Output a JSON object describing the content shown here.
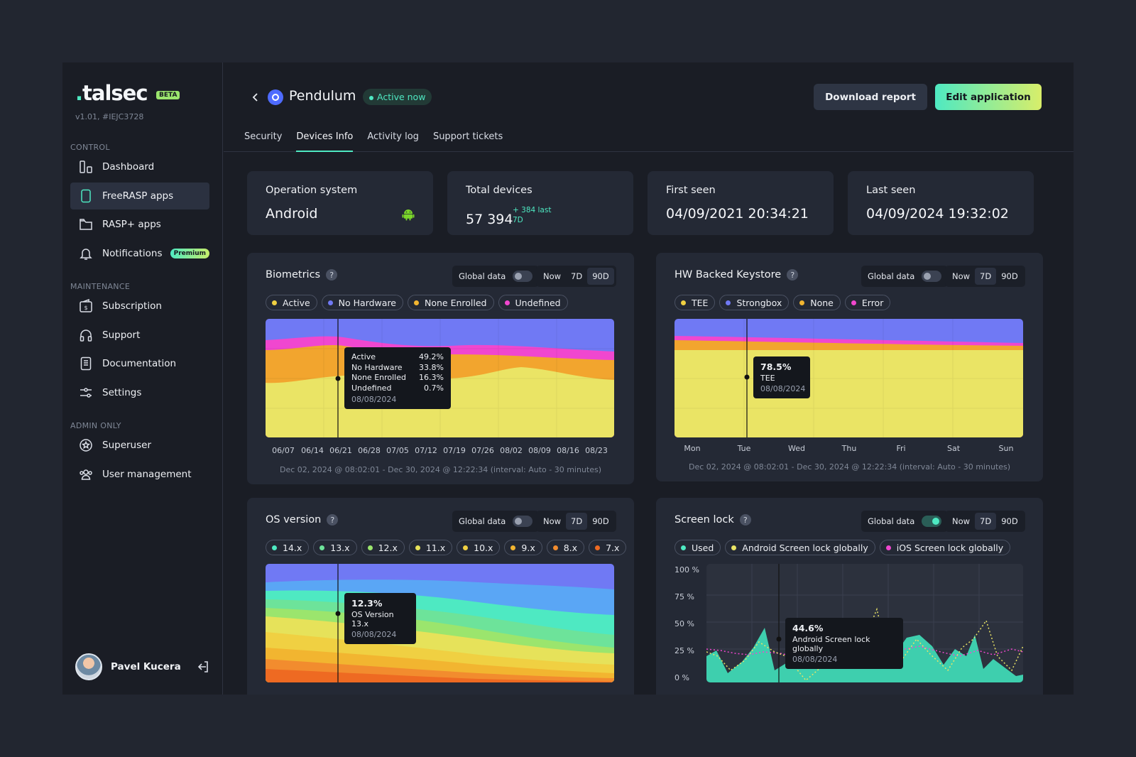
{
  "brand": {
    "logo_text": "talsec",
    "badge": "BETA",
    "version": "v1.01, #IEJC3728"
  },
  "sidebar": {
    "sections": [
      {
        "title": "CONTROL",
        "items": [
          {
            "label": "Dashboard",
            "icon": "dashboard-icon"
          },
          {
            "label": "FreeRASP apps",
            "icon": "phone-icon",
            "active": true
          },
          {
            "label": "RASP+ apps",
            "icon": "folder-icon"
          },
          {
            "label": "Notifications",
            "icon": "bell-icon",
            "badge": "Premium"
          }
        ]
      },
      {
        "title": "MAINTENANCE",
        "items": [
          {
            "label": "Subscription",
            "icon": "wallet-icon"
          },
          {
            "label": "Support",
            "icon": "headphones-icon"
          },
          {
            "label": "Documentation",
            "icon": "document-icon"
          },
          {
            "label": "Settings",
            "icon": "sliders-icon"
          }
        ]
      },
      {
        "title": "ADMIN ONLY",
        "items": [
          {
            "label": "Superuser",
            "icon": "star-badge-icon"
          },
          {
            "label": "User management",
            "icon": "users-icon"
          }
        ]
      }
    ],
    "user": {
      "name": "Pavel Kucera"
    }
  },
  "header": {
    "app_name": "Pendulum",
    "status": "Active now",
    "download_label": "Download report",
    "edit_label": "Edit application",
    "tabs": [
      {
        "label": "Security"
      },
      {
        "label": "Devices Info",
        "active": true
      },
      {
        "label": "Activity log"
      },
      {
        "label": "Support tickets"
      }
    ]
  },
  "stats": [
    {
      "label": "Operation system",
      "value": "Android",
      "icon": "android-icon"
    },
    {
      "label": "Total devices",
      "value": "57 394",
      "delta": "+ 384 last 7D"
    },
    {
      "label": "First seen",
      "value": "04/09/2021 20:34:21"
    },
    {
      "label": "Last seen",
      "value": "04/09/2024 19:32:02"
    }
  ],
  "controls": {
    "global_label": "Global data",
    "seg": [
      "Now",
      "7D",
      "90D"
    ]
  },
  "colors": {
    "accent": "#4ee9c2",
    "yellow": "#eae465",
    "orange": "#f2a52e",
    "pink": "#f047cf",
    "blue": "#7079f4"
  },
  "cards": {
    "biometrics": {
      "title": "Biometrics",
      "legend": [
        {
          "label": "Active",
          "color": "#f0d042"
        },
        {
          "label": "No Hardware",
          "color": "#7079f4"
        },
        {
          "label": "None Enrolled",
          "color": "#f2b530"
        },
        {
          "label": "Undefined",
          "color": "#f047cf"
        }
      ],
      "x_ticks": [
        "06/07",
        "06/14",
        "06/21",
        "06/28",
        "07/05",
        "07/12",
        "07/19",
        "07/26",
        "08/02",
        "08/09",
        "08/16",
        "08/23"
      ],
      "range": "Dec 02, 2024 @ 08:02:01 - Dec 30, 2024 @ 12:22:34 (interval: Auto - 30 minutes)",
      "tooltip": {
        "rows": [
          [
            "Active",
            "49.2%"
          ],
          [
            "No Hardware",
            "33.8%"
          ],
          [
            "None Enrolled",
            "16.3%"
          ],
          [
            "Undefined",
            "0.7%"
          ]
        ],
        "date": "08/08/2024"
      }
    },
    "hw": {
      "title": "HW Backed Keystore",
      "legend": [
        {
          "label": "TEE",
          "color": "#f0d042"
        },
        {
          "label": "Strongbox",
          "color": "#7079f4"
        },
        {
          "label": "None",
          "color": "#f2b530"
        },
        {
          "label": "Error",
          "color": "#f047cf"
        }
      ],
      "x_ticks": [
        "Mon",
        "Tue",
        "Wed",
        "Thu",
        "Fri",
        "Sat",
        "Sun"
      ],
      "range": "Dec 02, 2024 @ 08:02:01 - Dec 30, 2024 @ 12:22:34 (interval: Auto - 30 minutes)",
      "tooltip": {
        "value": "78.5%",
        "label": "TEE",
        "date": "08/08/2024"
      }
    },
    "os": {
      "title": "OS version",
      "legend": [
        {
          "label": "14.x",
          "color": "#4ee9c2"
        },
        {
          "label": "13.x",
          "color": "#6de39a"
        },
        {
          "label": "12.x",
          "color": "#9be56d"
        },
        {
          "label": "11.x",
          "color": "#e6e25a"
        },
        {
          "label": "10.x",
          "color": "#f0d042"
        },
        {
          "label": "9.x",
          "color": "#f2b530"
        },
        {
          "label": "8.x",
          "color": "#f28c2e"
        },
        {
          "label": "7.x",
          "color": "#ee6a22"
        }
      ],
      "tooltip": {
        "value": "12.3%",
        "label": "OS Version 13.x",
        "date": "08/08/2024"
      }
    },
    "screen": {
      "title": "Screen lock",
      "legend": [
        {
          "label": "Used",
          "color": "#4ee9c2"
        },
        {
          "label": "Android Screen lock globally",
          "color": "#eae465"
        },
        {
          "label": "iOS Screen lock globally",
          "color": "#f047cf"
        }
      ],
      "y_ticks": [
        "100 %",
        "75 %",
        "50 %",
        "25 %",
        "0 %"
      ],
      "tooltip": {
        "value": "44.6%",
        "label": "Android Screen lock globally",
        "date": "08/08/2024"
      }
    }
  }
}
